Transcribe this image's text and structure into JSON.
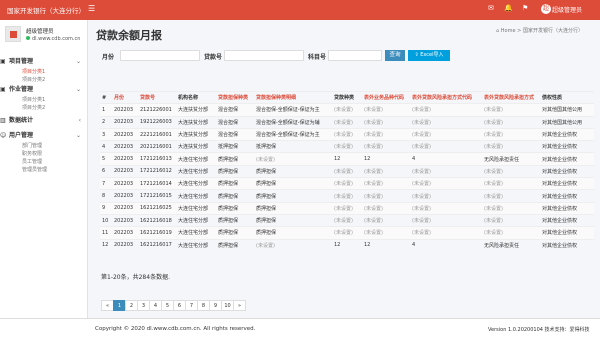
{
  "header": {
    "brand": "国家开发银行（大连分行）",
    "user": "超级管理员",
    "avatar_initial": "超",
    "icons": [
      "menu-icon",
      "mail-icon",
      "bell-icon",
      "flag-icon"
    ]
  },
  "sidebar": {
    "profile_name": "超级管理员",
    "profile_site": "dl.www.cdb.com.cn",
    "groups": [
      {
        "label": "项目管理",
        "icon": "folder-icon",
        "items": [
          "项目分类1",
          "项目分类2"
        ],
        "active": 0
      },
      {
        "label": "作业管理",
        "icon": "folder-icon",
        "items": [
          "项目分类1",
          "项目分类2"
        ]
      },
      {
        "label": "数据统计",
        "icon": "chart-icon",
        "items": []
      },
      {
        "label": "用户管理",
        "icon": "user-icon",
        "items": [
          "部门管理",
          "职务权限",
          "员工管理",
          "管理员管理"
        ]
      }
    ]
  },
  "page": {
    "title": "贷款余额月报",
    "breadcrumb_home": "Home",
    "breadcrumb_sep": ">",
    "breadcrumb_current": "国家开发银行（大连分行）"
  },
  "form": {
    "month_label": "月份",
    "loan_label": "贷款号",
    "subject_label": "科目号",
    "query_button": "查询",
    "excel_button": "Excel导入"
  },
  "table": {
    "headers": [
      "#",
      "月份",
      "贷款号",
      "机构名称",
      "贷款担保种类",
      "贷款担保种类明细",
      "贷款种类",
      "表外业务品种代码",
      "表外贷款风险承担方式代码",
      "表外贷款风险承担方式",
      "债权性质"
    ],
    "rows": [
      [
        "1",
        "202203",
        "2121226001",
        "大连扶贫分部",
        "混合担保",
        "混合担保-全额保证-保证为主",
        "(未设置)",
        "(未设置)",
        "(未设置)",
        "(未设置)",
        "对其他国其他公用"
      ],
      [
        "2",
        "202203",
        "1921226003",
        "大连扶贫分部",
        "混合担保",
        "混合担保-全额保证-保证为辅",
        "(未设置)",
        "(未设置)",
        "(未设置)",
        "(未设置)",
        "对其他国其他公用"
      ],
      [
        "3",
        "202203",
        "2221216001",
        "大连扶贫分部",
        "混合担保",
        "混合担保-全额保证-保证为主",
        "(未设置)",
        "(未设置)",
        "(未设置)",
        "(未设置)",
        "对其他企业债权"
      ],
      [
        "4",
        "202203",
        "2021216001",
        "大连扶贫分部",
        "抵押担保",
        "抵押担保",
        "(未设置)",
        "(未设置)",
        "(未设置)",
        "(未设置)",
        "对其他企业债权"
      ],
      [
        "5",
        "202203",
        "1721216013",
        "大连住宅分部",
        "质押担保",
        "(未设置)",
        "12",
        "12",
        "4",
        "无风险承担责任",
        "对其他企业债权"
      ],
      [
        "6",
        "202203",
        "1721216012",
        "大连住宅分部",
        "质押担保",
        "质押担保",
        "(未设置)",
        "(未设置)",
        "(未设置)",
        "(未设置)",
        "对其他企业债权"
      ],
      [
        "7",
        "202203",
        "1721216014",
        "大连住宅分部",
        "质押担保",
        "质押担保",
        "(未设置)",
        "(未设置)",
        "(未设置)",
        "(未设置)",
        "对其他企业债权"
      ],
      [
        "8",
        "202203",
        "1721216015",
        "大连住宅分部",
        "质押担保",
        "质押担保",
        "(未设置)",
        "(未设置)",
        "(未设置)",
        "(未设置)",
        "对其他企业债权"
      ],
      [
        "9",
        "202203",
        "1621216025",
        "大连住宅分部",
        "质押担保",
        "质押担保",
        "(未设置)",
        "(未设置)",
        "(未设置)",
        "(未设置)",
        "对其他企业债权"
      ],
      [
        "10",
        "202203",
        "1621216018",
        "大连住宅分部",
        "质押担保",
        "质押担保",
        "(未设置)",
        "(未设置)",
        "(未设置)",
        "(未设置)",
        "对其他企业债权"
      ],
      [
        "11",
        "202203",
        "1621216019",
        "大连住宅分部",
        "质押担保",
        "质押担保",
        "(未设置)",
        "(未设置)",
        "(未设置)",
        "(未设置)",
        "对其他企业债权"
      ],
      [
        "12",
        "202203",
        "1621216017",
        "大连住宅分部",
        "质押担保",
        "(未设置)",
        "12",
        "12",
        "4",
        "无风险承担责任",
        "对其他企业债权"
      ]
    ]
  },
  "summary": "第1-20条，共284条数据.",
  "pagination": [
    "«",
    "1",
    "2",
    "3",
    "4",
    "5",
    "6",
    "7",
    "8",
    "9",
    "10",
    "»"
  ],
  "pagination_current": "1",
  "footer": {
    "copyright": "Copyright © 2020 dl.www.cdb.com.cn. All rights reserved.",
    "version": "Version 1.0.20200104 技术支持：爱得科技"
  }
}
